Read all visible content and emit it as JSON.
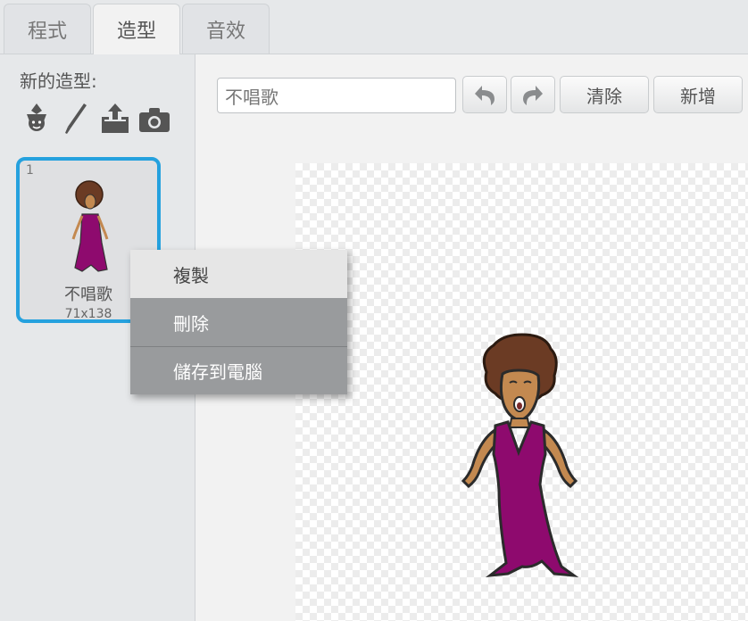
{
  "tabs": [
    {
      "label": "程式",
      "active": false
    },
    {
      "label": "造型",
      "active": true
    },
    {
      "label": "音效",
      "active": false
    }
  ],
  "sidebar": {
    "new_costume_label": "新的造型:",
    "icons": [
      "sprite-library-icon",
      "paint-brush-icon",
      "upload-icon",
      "camera-icon"
    ],
    "costume": {
      "number": "1",
      "name": "不唱歌",
      "size": "71x138"
    }
  },
  "editor": {
    "costume_name_value": "不唱歌",
    "undo_icon": "undo-icon",
    "redo_icon": "redo-icon",
    "clear_label": "清除",
    "add_label": "新增"
  },
  "context_menu": {
    "items": [
      "複製",
      "刪除",
      "儲存到電腦"
    ]
  },
  "colors": {
    "accent": "#25a1de",
    "dress": "#8e0a6e",
    "hair": "#6b3b24",
    "skin": "#c38950"
  }
}
